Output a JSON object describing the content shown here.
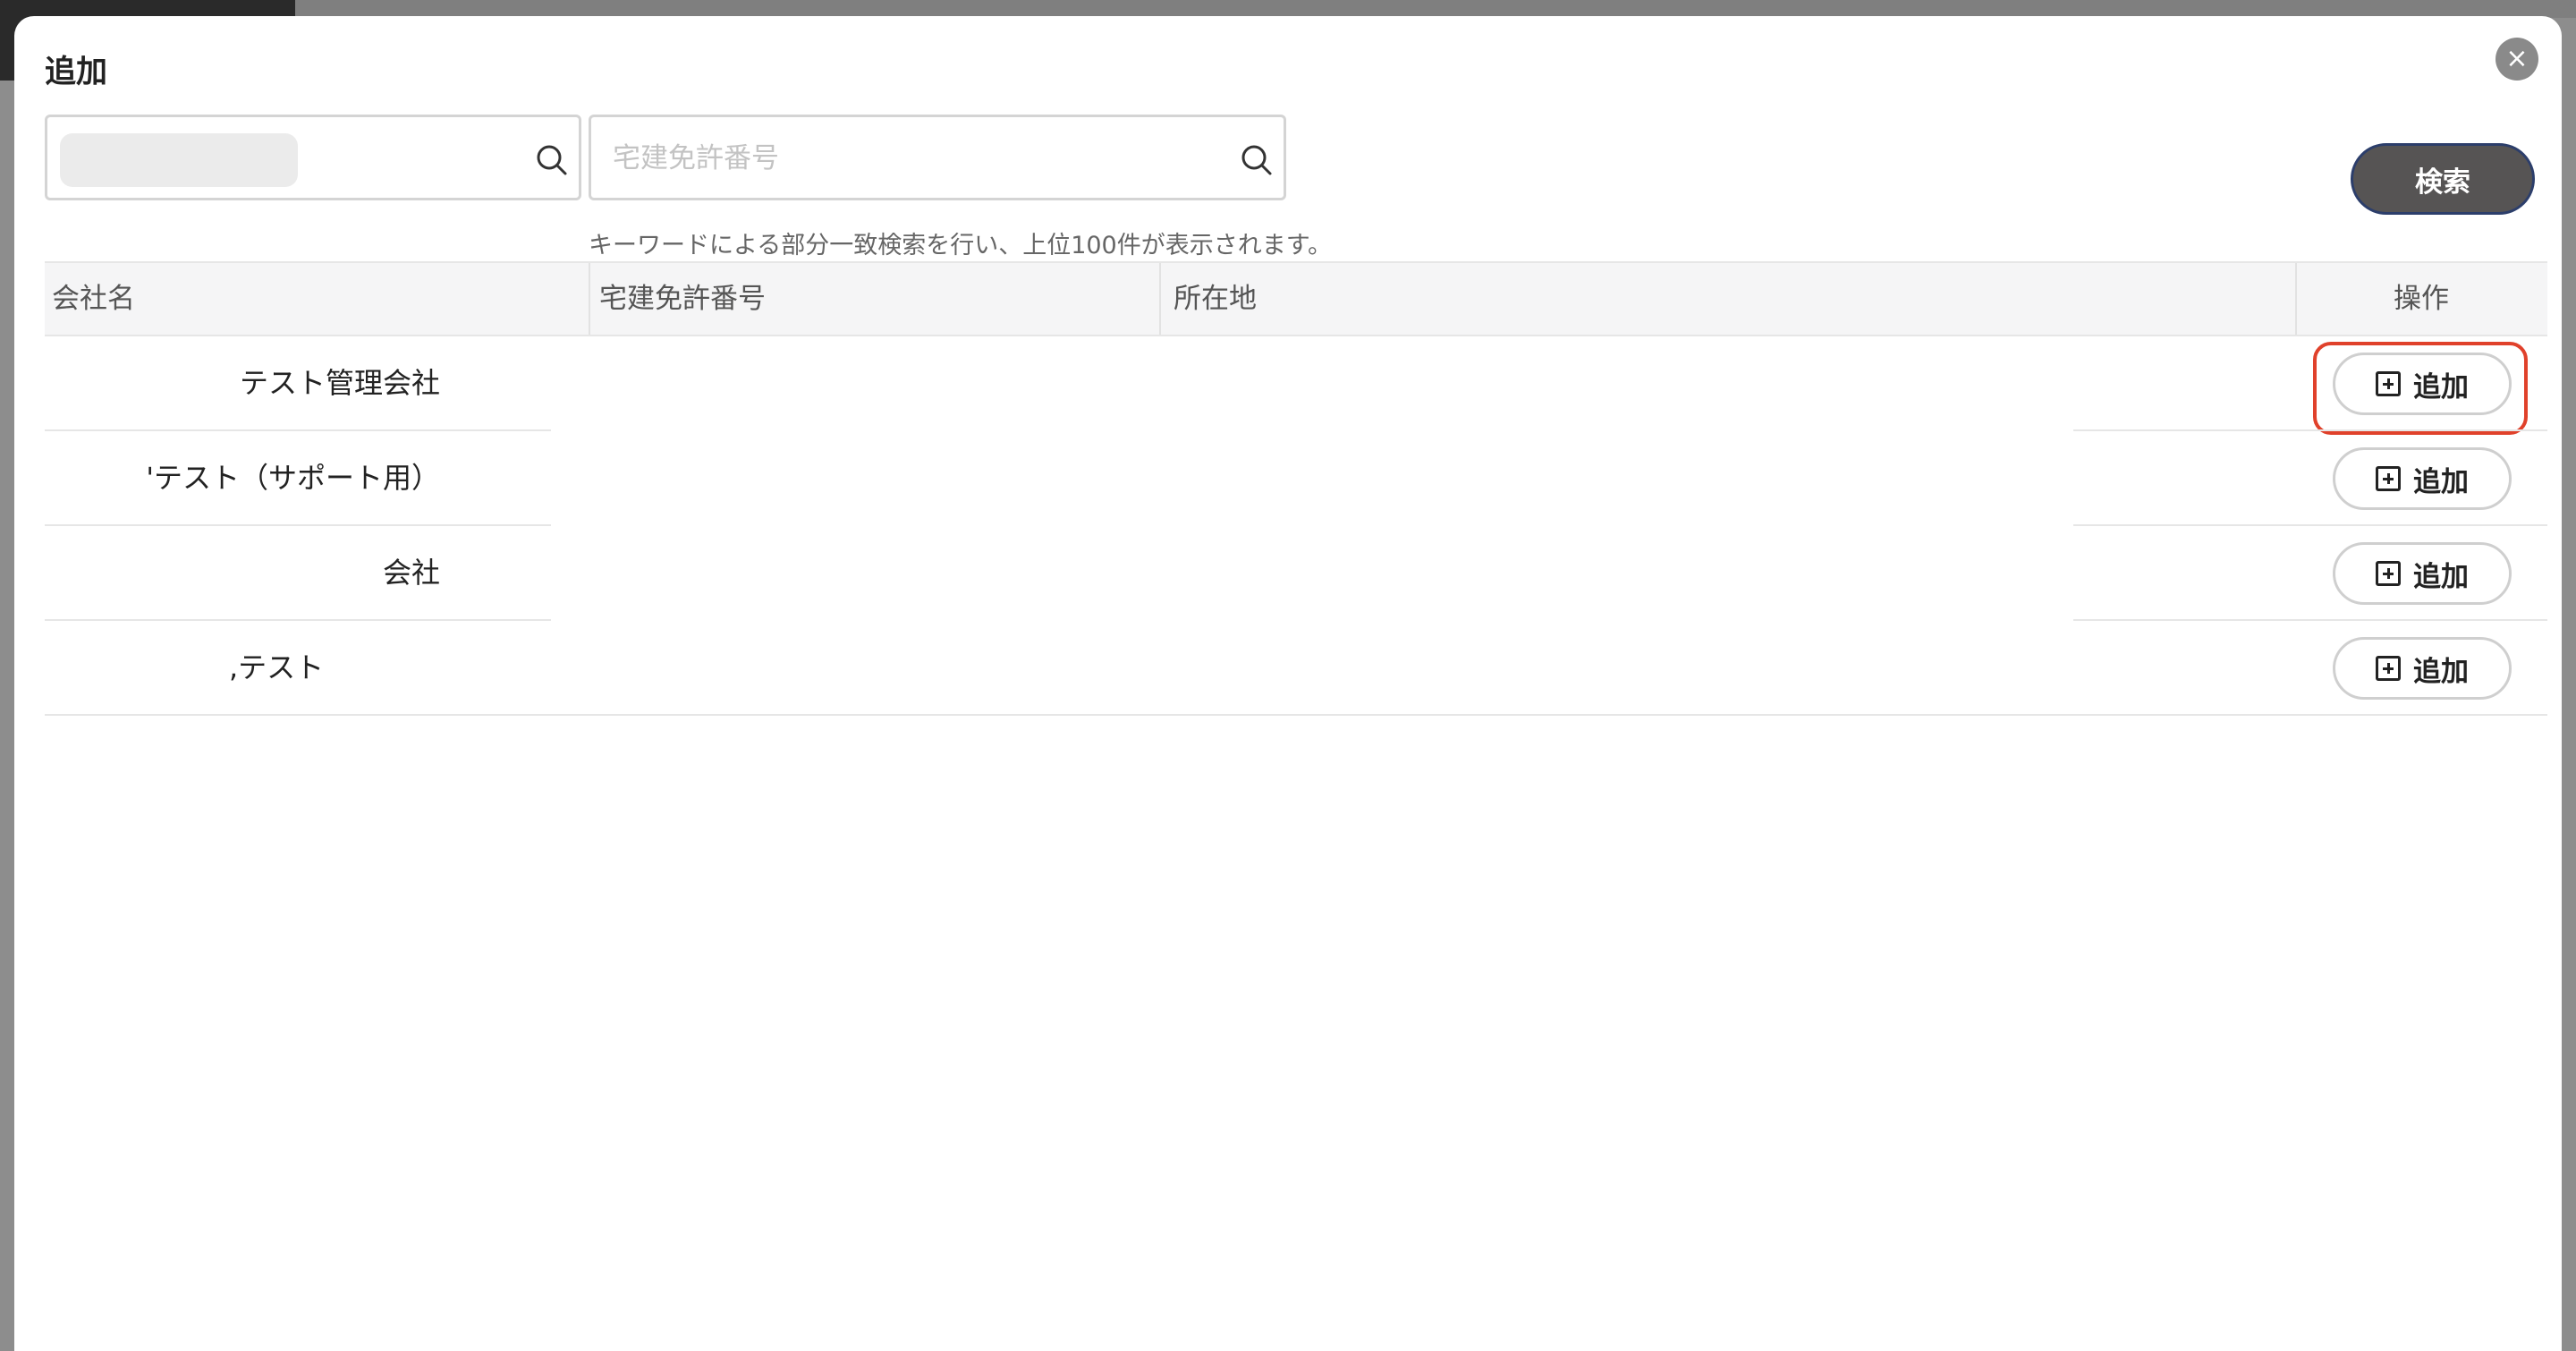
{
  "modal": {
    "title": "追加",
    "close_label": "×"
  },
  "search": {
    "company_placeholder": "",
    "license_placeholder": "宅建免許番号",
    "helper_text": "キーワードによる部分一致検索を行い、上位100件が表示されます。",
    "button_label": "検索"
  },
  "table": {
    "headers": {
      "company": "会社名",
      "license": "宅建免許番号",
      "address": "所在地",
      "ops": "操作"
    },
    "rows": [
      {
        "company": "テスト管理会社",
        "license": "",
        "address": "",
        "action": "追加"
      },
      {
        "company": "'テスト（サポート用）",
        "license": "",
        "address": "",
        "action": "追加"
      },
      {
        "company": "会社",
        "license": "",
        "address": "",
        "action": "追加"
      },
      {
        "company": ",テスト",
        "license": "",
        "address": "",
        "action": "追加"
      }
    ]
  },
  "colors": {
    "search_button_bg": "#565454",
    "highlight_ring": "#e0412b",
    "header_bg": "#f5f5f6"
  },
  "icons": {
    "search": "search-icon",
    "close": "close-icon",
    "add": "plus-square-icon"
  }
}
